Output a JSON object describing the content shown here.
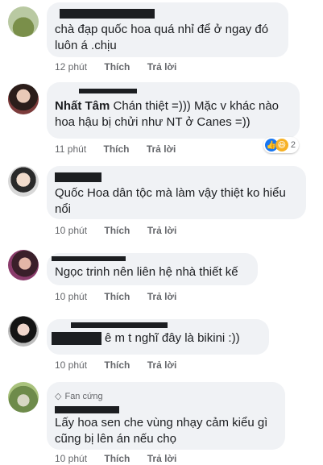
{
  "comments": [
    {
      "text": "chà đạp quốc hoa quá nhỉ để ở ngay đó luôn á .chịu",
      "time": "12 phút",
      "like": "Thích",
      "reply": "Trả lời"
    },
    {
      "name": "Nhất Tâm",
      "text": "Chán thiệt =))) Mặc v khác nào hoa hậu bị chửi như NT ở Canes =))",
      "time": "11 phút",
      "like": "Thích",
      "reply": "Trả lời",
      "reaction_count": "2"
    },
    {
      "text": "Quốc Hoa dân tộc mà làm vậy thiệt ko hiểu nổi",
      "time": "10 phút",
      "like": "Thích",
      "reply": "Trả lời"
    },
    {
      "text": "Ngọc trinh nên liên hệ nhà thiết kế",
      "time": "10 phút",
      "like": "Thích",
      "reply": "Trả lời"
    },
    {
      "text": "ê m t nghĩ đây là bikini :))",
      "time": "10 phút",
      "like": "Thích",
      "reply": "Trả lời"
    },
    {
      "badge": "Fan cứng",
      "text": "Lấy hoa sen che vùng nhạy cảm kiểu gì cũng bị lên án nếu chọ",
      "time": "10 phút",
      "like": "Thích",
      "reply": "Trả lời"
    }
  ],
  "colors": {
    "bubble": "#f0f2f5",
    "meta": "#65676b",
    "like_reaction": "#1877f2",
    "haha_reaction": "#f7b125"
  }
}
